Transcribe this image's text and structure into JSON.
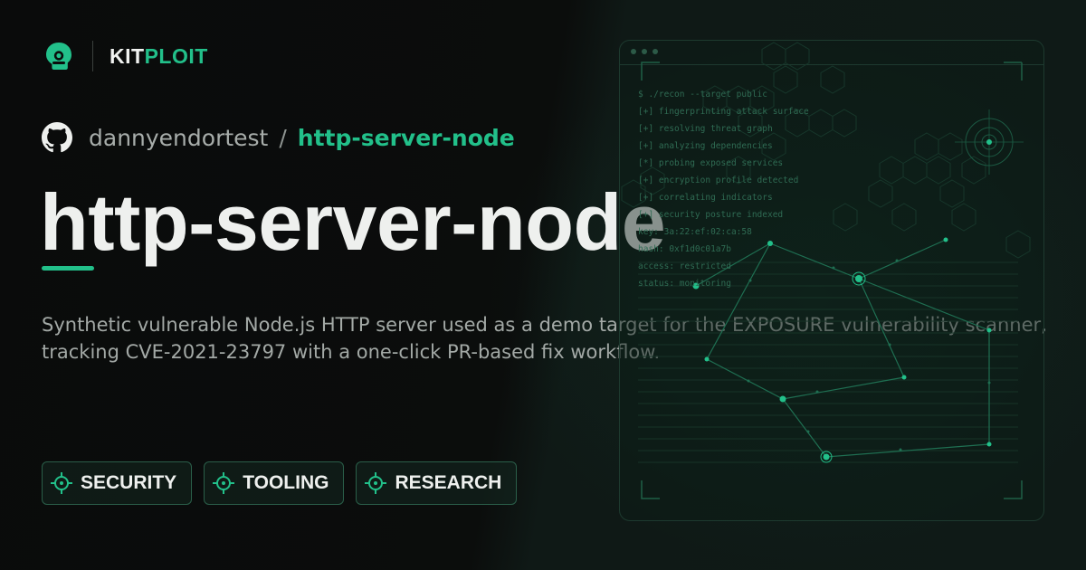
{
  "brand": {
    "name_part1": "KIT",
    "name_part2": "PLOIT",
    "logo_icon": "kitploit-logo-icon"
  },
  "repo": {
    "owner": "dannyendortest",
    "separator": "/",
    "name": "http-server-node",
    "icon": "github-icon"
  },
  "title": "http-server-node",
  "description_lines": [
    "Synthetic vulnerable Node.js HTTP server used as a demo target for the EXPOSURE vulnerability scanner,",
    "tracking CVE-2021-23797 with a one-click PR-based fix workflow."
  ],
  "tags": [
    {
      "label": "SECURITY",
      "icon": "crosshair-icon"
    },
    {
      "label": "TOOLING",
      "icon": "crosshair-icon"
    },
    {
      "label": "RESEARCH",
      "icon": "crosshair-icon"
    }
  ],
  "terminal": {
    "lines": [
      "$ ./recon --target public",
      "[+] fingerprinting attack surface",
      "[+] resolving threat graph",
      "[+] analyzing dependencies",
      "[*] probing exposed services",
      "[+] encryption profile detected",
      "[+] correlating indicators",
      "[+] security posture indexed",
      "key: 3a:22:ef:02:ca:58",
      "hash: 0xf1d0c01a7b",
      "access: restricted",
      "status: monitoring"
    ]
  },
  "colors": {
    "accent": "#22c08a",
    "background": "#0b0d0c",
    "title": "#eef0ee",
    "muted": "#a3a9a6"
  }
}
